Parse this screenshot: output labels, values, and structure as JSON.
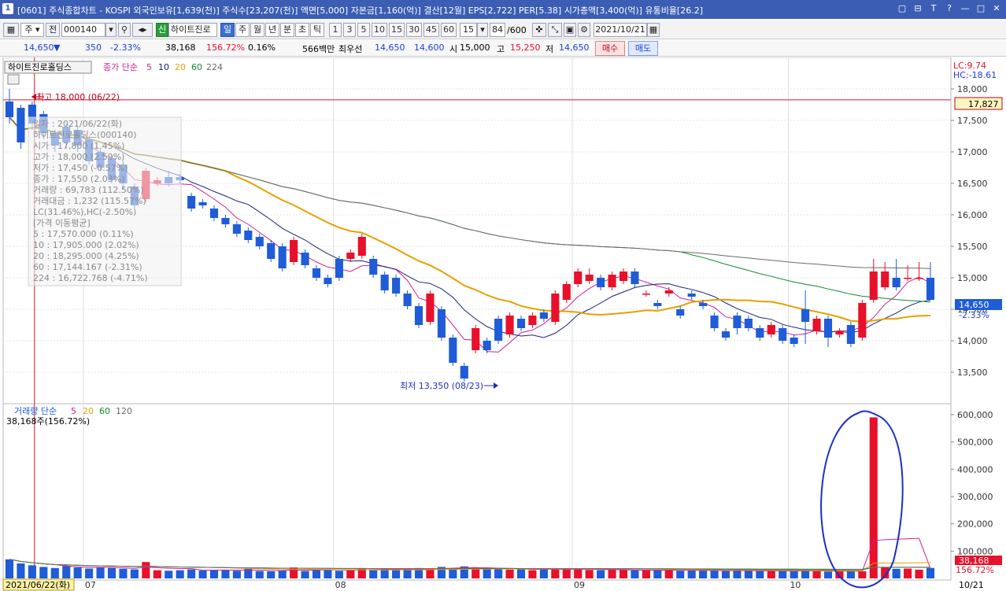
{
  "window": {
    "title": "[0601] 주식종합차트 - KOSPI 외국인보유[1,639(천)] 주식수[23,207(천)] 액면[5,000] 자본금[1,160(억)] 결산[12월] EPS[2,722] PER[5.38] 시가총액[3,400(억)] 유통비율[26.2]",
    "app_number": "1",
    "buttons": [
      "▢",
      "⊟",
      "T",
      "?",
      "—",
      "□",
      "✕"
    ]
  },
  "toolbar": {
    "period_select": "주",
    "prev_label": "전",
    "code": "000140",
    "stock_badge": "신",
    "stock_name": "하이트진로",
    "timeframes": [
      "일",
      "주",
      "월",
      "년",
      "분",
      "초",
      "틱"
    ],
    "active_timeframe": "일",
    "intervals": [
      "1",
      "3",
      "5",
      "10",
      "15",
      "30",
      "45",
      "60"
    ],
    "interval_value": "15",
    "count": "84",
    "count_total": "/600",
    "date": "2021/10/21"
  },
  "info": {
    "price": "14,650",
    "change_arrow": "▼",
    "change": "350",
    "change_pct": "-2.33%",
    "volume": "38,168",
    "volume_ratio": "156.72%",
    "turnover": "0.16%",
    "amount": "566백만",
    "best_label": "최우선",
    "ask": "14,650",
    "bid": "14,600",
    "open_label": "시",
    "open": "15,000",
    "high_label": "고",
    "high": "15,250",
    "low_label": "저",
    "low": "14,650",
    "buy_button": "매수",
    "sell_button": "매도"
  },
  "price_panel": {
    "name_box": "하이트진로홀딩스",
    "legend_prefix": "종가 단순",
    "ma_periods": [
      "5",
      "10",
      "20",
      "60",
      "224"
    ],
    "ma_colors": [
      "#d0209a",
      "#1a237e",
      "#e6a100",
      "#138a2e",
      "#6b6b6b"
    ],
    "lc_label": "LC:9.74",
    "hc_label": "HC:-18.61",
    "high_annotation": "최고 18,000 (06/22)",
    "low_annotation": "최저 13,350 (08/23)",
    "ref_price_label": "17,827",
    "current_price_label": "14,650",
    "current_change_label": "-2.33%",
    "y_ticks": [
      "18,000",
      "17,500",
      "17,000",
      "16,500",
      "16,000",
      "15,500",
      "15,000",
      "14,500",
      "14,000",
      "13,500"
    ],
    "tooltip_lines": [
      "일자     : 2021/06/22(화)",
      "하이트진로홀딩스(000140)",
      "시가     : 17,800 (1.45%)",
      "고가     : 18,000 (2.59%)",
      "저가     : 17,450 (-0.57%)",
      "종가     : 17,550 (2.03%)",
      "거래량   : 69,783 (112.50%)",
      "거래대금 : 1,232 (115.57%)",
      "LC(31.46%),HC(-2.50%)",
      "[가격 이동평균]",
      "5        : 17,570.000 (0.11%)",
      "10       : 17,905.000 (2.02%)",
      "20       : 18,295.000 (4.25%)",
      "60       : 17,144.167 (-2.31%)",
      "224      : 16,722.768 (-4.71%)"
    ]
  },
  "volume_panel": {
    "legend_prefix": "거래량 단순",
    "ma_periods": [
      "5",
      "20",
      "60",
      "120"
    ],
    "ma_colors": [
      "#d0209a",
      "#e6a100",
      "#138a2e",
      "#6b6b6b"
    ],
    "value_label": "38,168주(156.72%)",
    "y_ticks": [
      "600,000",
      "500,000",
      "400,000",
      "300,000",
      "200,000",
      "100,000"
    ],
    "right_volume": "38,168",
    "right_ratio": "156.72%"
  },
  "x_axis": {
    "cursor_date": "2021/06/22(화)",
    "month_labels": [
      "07",
      "08",
      "09",
      "10"
    ],
    "end_label": "10/21"
  },
  "colors": {
    "up": "#e8102a",
    "down": "#1e5cd8",
    "highlight_circle": "#1c2fc9",
    "title_bar": "#3b5db3"
  },
  "chart_data": {
    "type": "candlestick",
    "title": "하이트진로홀딩스",
    "x": [
      "06/22",
      "06/23",
      "06/24",
      "06/25",
      "06/28",
      "06/29",
      "06/30",
      "07/01",
      "07/02",
      "07/05",
      "07/06",
      "07/07",
      "07/08",
      "07/09",
      "07/12",
      "07/13",
      "07/14",
      "07/15",
      "07/16",
      "07/19",
      "07/20",
      "07/21",
      "07/22",
      "07/23",
      "07/26",
      "07/27",
      "07/28",
      "07/29",
      "07/30",
      "08/02",
      "08/03",
      "08/04",
      "08/05",
      "08/06",
      "08/09",
      "08/10",
      "08/11",
      "08/12",
      "08/13",
      "08/17",
      "08/18",
      "08/19",
      "08/20",
      "08/23",
      "08/24",
      "08/25",
      "08/26",
      "08/27",
      "08/30",
      "08/31",
      "09/01",
      "09/02",
      "09/03",
      "09/06",
      "09/07",
      "09/08",
      "09/09",
      "09/10",
      "09/13",
      "09/14",
      "09/15",
      "09/16",
      "09/17",
      "09/23",
      "09/24",
      "09/27",
      "09/28",
      "09/29",
      "09/30",
      "10/01",
      "10/05",
      "10/06",
      "10/07",
      "10/08",
      "10/12",
      "10/13",
      "10/14",
      "10/15",
      "10/18",
      "10/19",
      "10/20",
      "10/21"
    ],
    "open": [
      17800,
      17700,
      17750,
      17600,
      17300,
      17400,
      17350,
      17200,
      17000,
      16900,
      16800,
      16450,
      16250,
      16500,
      16600,
      16600,
      16300,
      16200,
      16100,
      15950,
      15850,
      15750,
      15650,
      15550,
      15500,
      15250,
      15400,
      15150,
      15000,
      15300,
      15300,
      15350,
      15300,
      15050,
      15000,
      14750,
      14550,
      14300,
      14500,
      14050,
      13600,
      13850,
      14000,
      14350,
      14100,
      14350,
      14250,
      14450,
      14300,
      14650,
      14900,
      14950,
      15000,
      14850,
      14950,
      15100,
      14750,
      14600,
      14750,
      14500,
      14750,
      14600,
      14400,
      14150,
      14400,
      14350,
      14200,
      14100,
      14200,
      14050,
      14500,
      14150,
      14350,
      14100,
      14250,
      14050,
      14650,
      14850,
      15000,
      15000,
      15000,
      15000
    ],
    "close": [
      17550,
      17150,
      17450,
      17300,
      17100,
      17150,
      17100,
      16850,
      16750,
      16550,
      16500,
      16150,
      16700,
      16550,
      16500,
      16550,
      16100,
      16150,
      15950,
      15850,
      15700,
      15600,
      15500,
      15300,
      15150,
      15600,
      15200,
      15000,
      14900,
      15000,
      15400,
      15650,
      15050,
      14800,
      14750,
      14550,
      14250,
      14750,
      14050,
      13650,
      13400,
      14200,
      13850,
      14000,
      14400,
      14200,
      14400,
      14350,
      14750,
      14900,
      15100,
      15050,
      14850,
      15050,
      15100,
      14900,
      14750,
      14550,
      14800,
      14400,
      14700,
      14550,
      14200,
      14050,
      14200,
      14200,
      14050,
      14250,
      14000,
      13950,
      14300,
      14350,
      14050,
      14150,
      13950,
      14600,
      15100,
      15100,
      14850,
      15000,
      15000,
      14650
    ],
    "high": [
      18000,
      17750,
      17800,
      17650,
      17350,
      17450,
      17400,
      17250,
      17050,
      16950,
      16850,
      16500,
      16750,
      16600,
      16700,
      16650,
      16350,
      16250,
      16150,
      16000,
      15900,
      15800,
      15700,
      15600,
      15550,
      15650,
      15450,
      15200,
      15050,
      15350,
      15450,
      15700,
      15350,
      15100,
      15050,
      14800,
      14600,
      14800,
      14550,
      14100,
      13650,
      14250,
      14050,
      14400,
      14450,
      14400,
      14450,
      14500,
      14800,
      14950,
      15150,
      15150,
      15050,
      15100,
      15150,
      15150,
      14800,
      14650,
      14850,
      14550,
      14800,
      14650,
      14450,
      14200,
      14450,
      14400,
      14250,
      14300,
      14250,
      14100,
      14800,
      14400,
      14400,
      14200,
      14300,
      14650,
      15300,
      15250,
      15300,
      15200,
      15250,
      15250
    ],
    "low": [
      17450,
      17050,
      17350,
      17200,
      17000,
      17050,
      17000,
      16800,
      16700,
      16500,
      16400,
      16100,
      16200,
      16450,
      16450,
      16500,
      16050,
      16100,
      15900,
      15800,
      15650,
      15550,
      15450,
      15250,
      15100,
      15200,
      15150,
      14950,
      14850,
      14950,
      15250,
      15300,
      15000,
      14750,
      14700,
      14500,
      14200,
      14250,
      14000,
      13600,
      13350,
      13800,
      13800,
      13950,
      14050,
      14150,
      14200,
      14300,
      14250,
      14600,
      14850,
      14900,
      14800,
      14800,
      14900,
      14850,
      14700,
      14500,
      14700,
      14350,
      14650,
      14500,
      14150,
      14000,
      14100,
      14150,
      14000,
      14050,
      13950,
      13900,
      13950,
      14100,
      13900,
      14050,
      13900,
      14000,
      14600,
      14800,
      14800,
      14950,
      14950,
      14650
    ],
    "volume": [
      69783,
      55000,
      48000,
      42000,
      38000,
      45000,
      40000,
      36000,
      42000,
      38000,
      35000,
      33000,
      60000,
      30000,
      28000,
      30000,
      33000,
      29000,
      31000,
      30000,
      28000,
      35000,
      27000,
      26000,
      29000,
      40000,
      27000,
      30000,
      32000,
      28000,
      30000,
      37000,
      33000,
      36000,
      30000,
      34000,
      38000,
      37000,
      42000,
      36000,
      44000,
      40000,
      33000,
      35000,
      32000,
      34000,
      30000,
      36000,
      35000,
      33000,
      34000,
      31000,
      30000,
      32000,
      31000,
      30000,
      29000,
      30000,
      31000,
      28000,
      29000,
      28000,
      30000,
      27000,
      29000,
      28000,
      27000,
      26000,
      28000,
      27000,
      30000,
      26000,
      25000,
      26000,
      27000,
      26000,
      590000,
      40000,
      35000,
      36000,
      32000,
      38168
    ],
    "ylim": [
      13100,
      18400
    ],
    "volume_ylim": [
      0,
      640000
    ]
  }
}
